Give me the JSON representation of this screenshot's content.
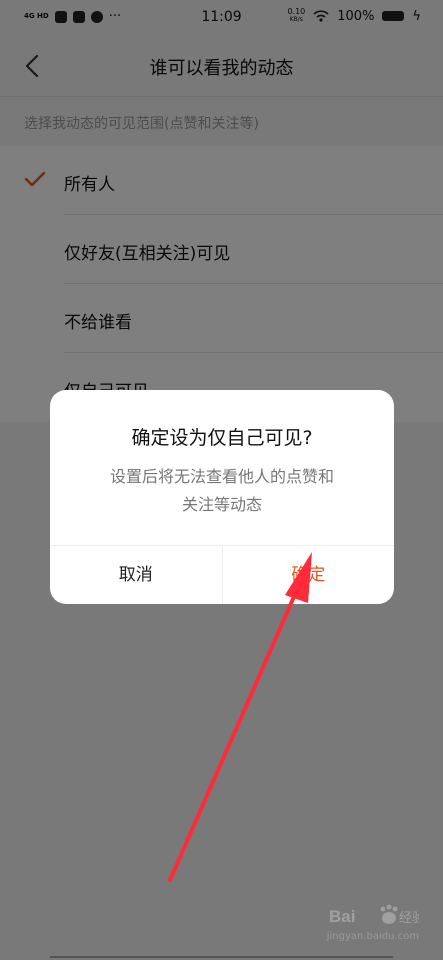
{
  "status_bar": {
    "network": "4G HD",
    "time": "11:09",
    "speed_value": "0.10",
    "speed_unit": "KB/s",
    "battery": "100%"
  },
  "nav": {
    "back_icon": "chevron-left-icon",
    "title": "谁可以看我的动态"
  },
  "settings": {
    "hint": "选择我动态的可见范围(点赞和关注等)",
    "options": [
      {
        "label": "所有人",
        "selected": true
      },
      {
        "label": "仅好友(互相关注)可见",
        "selected": false
      },
      {
        "label": "不给谁看",
        "selected": false
      },
      {
        "label": "仅自己可见",
        "selected": false
      }
    ],
    "accent_color": "#e8541f"
  },
  "dialog": {
    "title": "确定设为仅自己可见?",
    "message_line1": "设置后将无法查看他人的点赞和",
    "message_line2": "关注等动态",
    "cancel_label": "取消",
    "confirm_label": "确定"
  },
  "annotation": {
    "arrow_color": "#ff2a3a"
  },
  "watermark": {
    "logo_text": "Bai经验",
    "url": "jingyan.baidu.com"
  }
}
